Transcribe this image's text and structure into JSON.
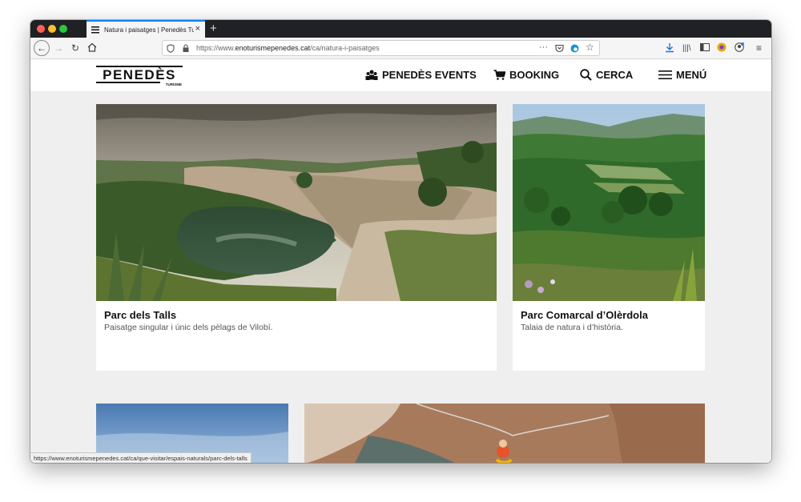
{
  "browser": {
    "tab_title": "Natura i paisatges | Penedès Tu",
    "tab_close": "×",
    "new_tab": "+",
    "url_prefix": "https://www.",
    "url_domain": "enoturismepenedes.cat",
    "url_path": "/ca/natura-i-paisatges",
    "status_url": "https://www.enoturismepenedes.cat/ca/que-visitar/espais-naturals/parc-dels-talls",
    "colors": {
      "accent": "#0a84ff",
      "tabbar": "#202124",
      "close": "#ff5f57",
      "minimize": "#febc2e",
      "maximize": "#28c840"
    }
  },
  "site": {
    "logo_text": "PENEDÈS",
    "logo_sub": "TURISME",
    "nav": [
      {
        "label": "PENEDÈS EVENTS",
        "icon": "people-icon"
      },
      {
        "label": "BOOKING",
        "icon": "cart-icon"
      },
      {
        "label": "CERCA",
        "icon": "search-icon"
      },
      {
        "label": "MENÚ",
        "icon": "menu-icon"
      }
    ]
  },
  "cards": [
    {
      "title": "Parc dels Talls",
      "description": "Paisatge singular i únic dels pèlags de Vilobí."
    },
    {
      "title": "Parc Comarcal d’Olèrdola",
      "description": "Talaia de natura i d’història."
    }
  ]
}
